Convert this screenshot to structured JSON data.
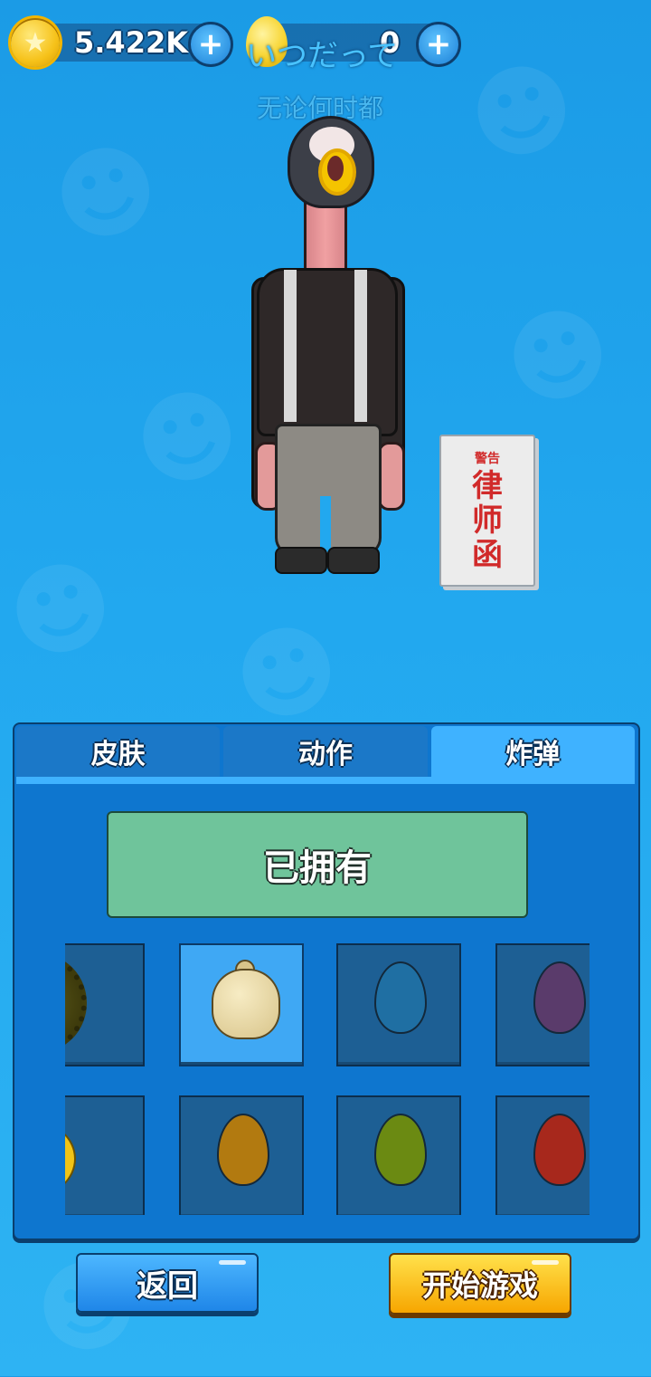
{
  "currency": {
    "coins": "5.422K",
    "gems": "0"
  },
  "lyrics": {
    "japanese": "いつだって",
    "chinese": "无论何时都"
  },
  "letter": {
    "warning": "警告",
    "line1": "律",
    "line2": "师",
    "line3": "函"
  },
  "tabs": [
    {
      "label": "皮肤",
      "active": false
    },
    {
      "label": "动作",
      "active": false
    },
    {
      "label": "炸弹",
      "active": true
    }
  ],
  "status_button": {
    "label": "已拥有"
  },
  "items": [
    {
      "kind": "durian",
      "selected": false
    },
    {
      "kind": "bell",
      "selected": true
    },
    {
      "kind": "egg",
      "color": "#1f6fa3",
      "selected": false
    },
    {
      "kind": "egg",
      "color": "#5a3b6b",
      "selected": false
    },
    {
      "kind": "duck",
      "selected": false
    },
    {
      "kind": "egg",
      "color": "#b27a10",
      "selected": false
    },
    {
      "kind": "egg",
      "color": "#6b8a12",
      "selected": false
    },
    {
      "kind": "egg",
      "color": "#a7281c",
      "selected": false
    }
  ],
  "buttons": {
    "back": "返回",
    "start": "开始游戏"
  },
  "colors": {
    "background": "#22a8ef",
    "panel": "#0e76cf",
    "owned_green": "#6fc49b",
    "start_yellow": "#f7c21a"
  }
}
